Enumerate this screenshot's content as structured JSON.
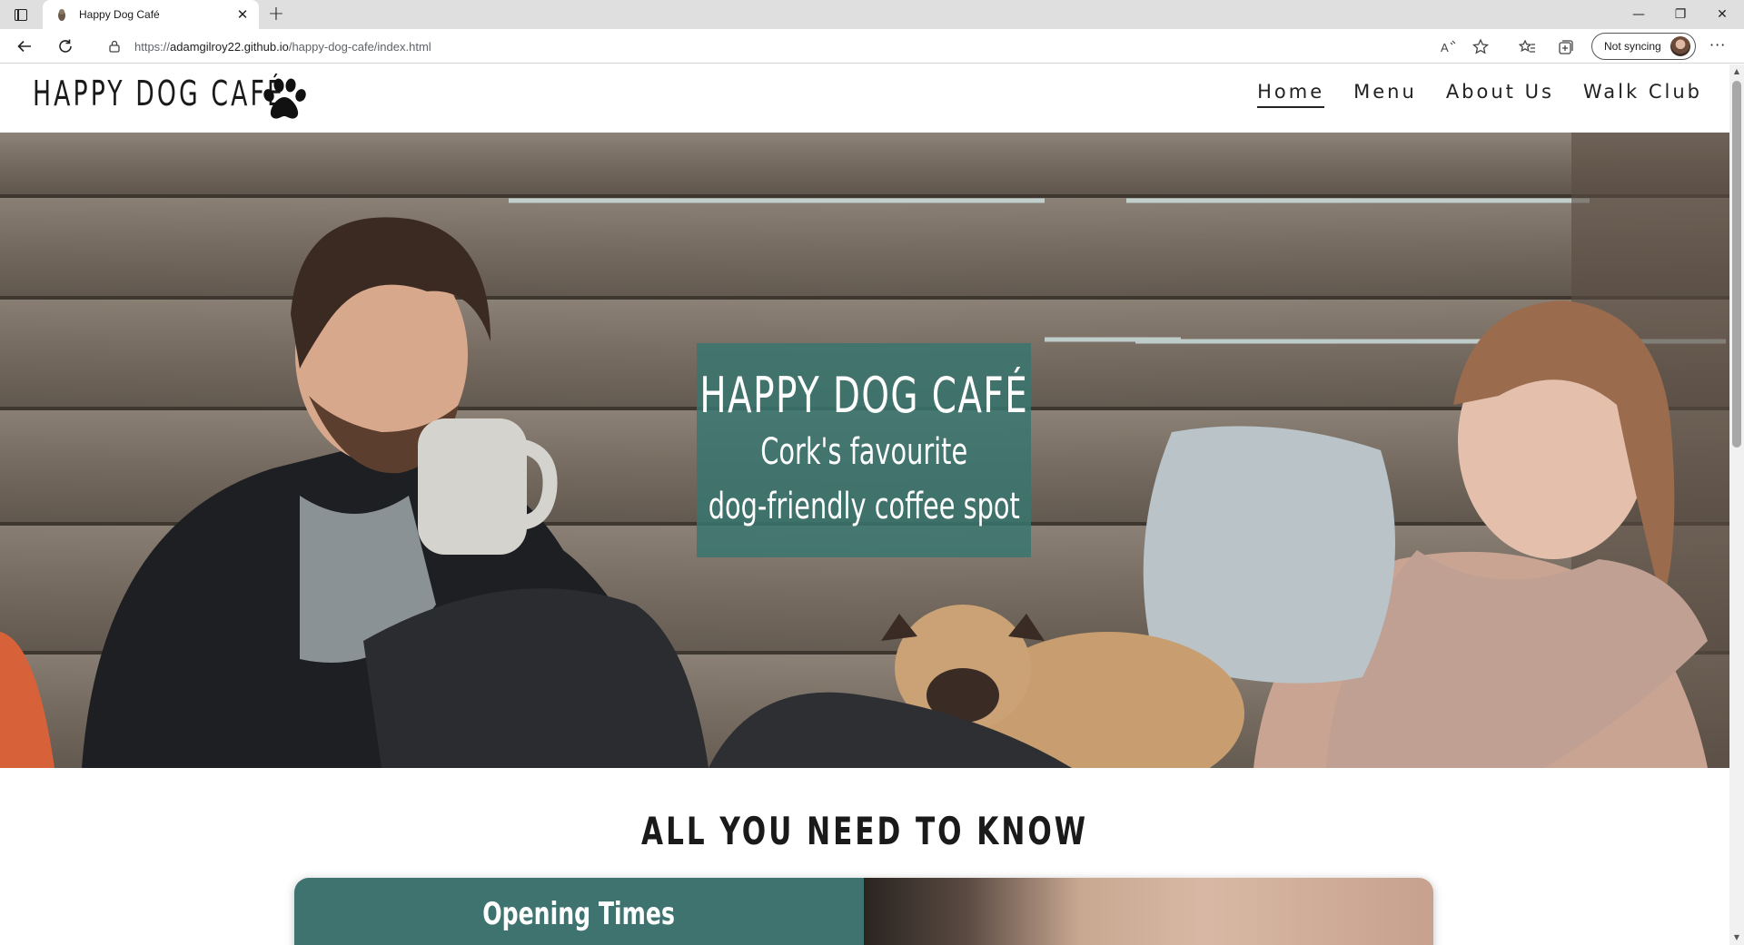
{
  "browser": {
    "tab_title": "Happy Dog Café",
    "new_tab_symbol": "+",
    "tab_close_symbol": "✕",
    "url_prefix": "https://",
    "url_host": "adamgilroy22.github.io",
    "url_path": "/happy-dog-cafe/index.html",
    "sync_label": "Not syncing",
    "more_symbol": "···",
    "minimize_symbol": "—",
    "restore_symbol": "❐",
    "close_symbol": "✕"
  },
  "site": {
    "logo_text": "HAPPY DOG CAFÉ",
    "nav": [
      {
        "label": "Home",
        "active": true
      },
      {
        "label": "Menu",
        "active": false
      },
      {
        "label": "About Us",
        "active": false
      },
      {
        "label": "Walk Club",
        "active": false
      }
    ]
  },
  "hero": {
    "title": "HAPPY DOG CAFÉ",
    "subtitle_line1": "Cork's favourite",
    "subtitle_line2": "dog-friendly coffee spot",
    "overlay_color": "#387670"
  },
  "info": {
    "section_title": "ALL YOU NEED TO KNOW",
    "card_heading": "Opening Times",
    "card_color": "#3e7370"
  }
}
